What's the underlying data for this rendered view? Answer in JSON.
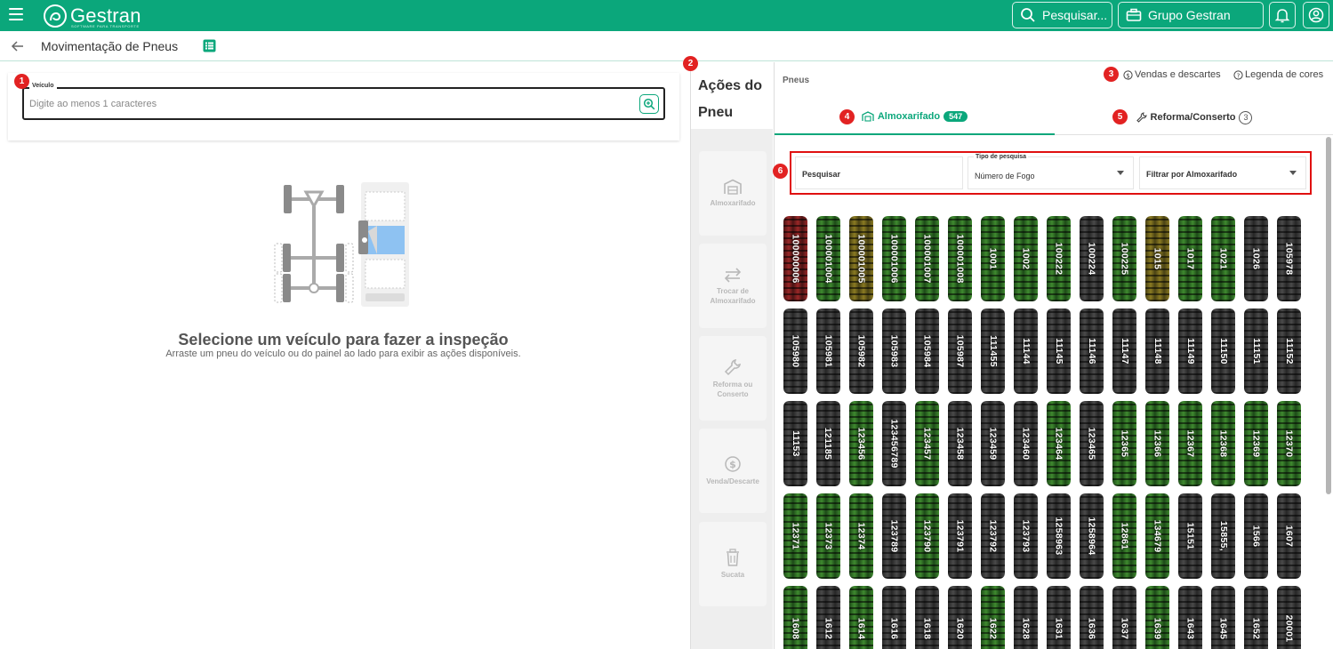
{
  "app": {
    "brand": "Gestran",
    "brand_sub": "SOFTWARE PARA TRANSPORTE",
    "search_label": "Pesquisar...",
    "company_label": "Grupo Gestran",
    "accent": "#0ba77b"
  },
  "page": {
    "title": "Movimentação de Pneus"
  },
  "markers": [
    "1",
    "2",
    "3",
    "4",
    "5",
    "6"
  ],
  "vehicle": {
    "label": "Veículo",
    "placeholder": "Digite ao menos 1 caracteres"
  },
  "empty_state": {
    "title": "Selecione um veículo para fazer a inspeção",
    "subtitle": "Arraste um pneu do veículo ou do painel ao lado para exibir as ações disponíveis."
  },
  "actions": {
    "title": "Ações do Pneu",
    "items": [
      {
        "label": "Almoxarifado",
        "icon": "warehouse-icon"
      },
      {
        "label": "Trocar de Almoxarifado",
        "icon": "swap-icon"
      },
      {
        "label": "Reforma ou Conserto",
        "icon": "wrench-icon"
      },
      {
        "label": "Venda/Descarte",
        "icon": "dollar-icon"
      },
      {
        "label": "Sucata",
        "icon": "trash-icon"
      }
    ]
  },
  "panel": {
    "title": "Pneus",
    "link_sales": "Vendas e descartes",
    "link_legend": "Legenda de cores",
    "tabs": [
      {
        "label": "Almoxarifado",
        "count": "547",
        "active": true
      },
      {
        "label": "Reforma/Conserto",
        "count": "3",
        "active": false
      }
    ],
    "filters": {
      "search_label": "Pesquisar",
      "type_label": "Tipo de pesquisa",
      "type_value": "Número de Fogo",
      "warehouse_label": "Filtrar por Almoxarifado"
    }
  },
  "tires": [
    {
      "id": "100000006",
      "color": "red"
    },
    {
      "id": "100001004",
      "color": "green"
    },
    {
      "id": "100001005",
      "color": "yellow"
    },
    {
      "id": "100001006",
      "color": "green"
    },
    {
      "id": "100001007",
      "color": "green"
    },
    {
      "id": "100001008",
      "color": "green"
    },
    {
      "id": "1001",
      "color": "green"
    },
    {
      "id": "1002",
      "color": "green"
    },
    {
      "id": "100222",
      "color": "green"
    },
    {
      "id": "100224",
      "color": "gray"
    },
    {
      "id": "100225",
      "color": "green"
    },
    {
      "id": "1015",
      "color": "yellow"
    },
    {
      "id": "1017",
      "color": "green"
    },
    {
      "id": "1021",
      "color": "green"
    },
    {
      "id": "1026",
      "color": "gray"
    },
    {
      "id": "105978",
      "color": "gray"
    },
    {
      "id": "105980",
      "color": "gray"
    },
    {
      "id": "105981",
      "color": "gray"
    },
    {
      "id": "105982",
      "color": "gray"
    },
    {
      "id": "105983",
      "color": "gray"
    },
    {
      "id": "105984",
      "color": "gray"
    },
    {
      "id": "105987",
      "color": "gray"
    },
    {
      "id": "111455",
      "color": "gray"
    },
    {
      "id": "11144",
      "color": "gray"
    },
    {
      "id": "11145",
      "color": "gray"
    },
    {
      "id": "11146",
      "color": "gray"
    },
    {
      "id": "11147",
      "color": "gray"
    },
    {
      "id": "11148",
      "color": "gray"
    },
    {
      "id": "11149",
      "color": "gray"
    },
    {
      "id": "11150",
      "color": "gray"
    },
    {
      "id": "11151",
      "color": "gray"
    },
    {
      "id": "11152",
      "color": "gray"
    },
    {
      "id": "11153",
      "color": "gray"
    },
    {
      "id": "121185",
      "color": "gray"
    },
    {
      "id": "123456",
      "color": "green"
    },
    {
      "id": "123456789",
      "color": "gray"
    },
    {
      "id": "123457",
      "color": "green"
    },
    {
      "id": "123458",
      "color": "gray"
    },
    {
      "id": "123459",
      "color": "gray"
    },
    {
      "id": "123460",
      "color": "gray"
    },
    {
      "id": "123464",
      "color": "green"
    },
    {
      "id": "123465",
      "color": "gray"
    },
    {
      "id": "12365",
      "color": "green"
    },
    {
      "id": "12366",
      "color": "green"
    },
    {
      "id": "12367",
      "color": "green"
    },
    {
      "id": "12368",
      "color": "green"
    },
    {
      "id": "12369",
      "color": "green"
    },
    {
      "id": "12370",
      "color": "green"
    },
    {
      "id": "12371",
      "color": "green"
    },
    {
      "id": "12373",
      "color": "green"
    },
    {
      "id": "12374",
      "color": "green"
    },
    {
      "id": "123789",
      "color": "gray"
    },
    {
      "id": "123790",
      "color": "green"
    },
    {
      "id": "123791",
      "color": "gray"
    },
    {
      "id": "123792",
      "color": "gray"
    },
    {
      "id": "123793",
      "color": "gray"
    },
    {
      "id": "1258963",
      "color": "gray"
    },
    {
      "id": "1258964",
      "color": "gray"
    },
    {
      "id": "12861",
      "color": "green"
    },
    {
      "id": "134679",
      "color": "green"
    },
    {
      "id": "15151",
      "color": "gray"
    },
    {
      "id": "15855,",
      "color": "gray"
    },
    {
      "id": "1566",
      "color": "gray"
    },
    {
      "id": "1607",
      "color": "gray"
    },
    {
      "id": "1608",
      "color": "green"
    },
    {
      "id": "1612",
      "color": "gray"
    },
    {
      "id": "1614",
      "color": "green"
    },
    {
      "id": "1616",
      "color": "gray"
    },
    {
      "id": "1618",
      "color": "gray"
    },
    {
      "id": "1620",
      "color": "gray"
    },
    {
      "id": "1622",
      "color": "green"
    },
    {
      "id": "1628",
      "color": "gray"
    },
    {
      "id": "1631",
      "color": "gray"
    },
    {
      "id": "1636",
      "color": "gray"
    },
    {
      "id": "1637",
      "color": "gray"
    },
    {
      "id": "1639",
      "color": "green"
    },
    {
      "id": "1643",
      "color": "gray"
    },
    {
      "id": "1645",
      "color": "gray"
    },
    {
      "id": "1652",
      "color": "gray"
    },
    {
      "id": "20001",
      "color": "gray"
    }
  ],
  "tire_colors": {
    "green": [
      "#1d4a18",
      "#3f8a2f"
    ],
    "gray": [
      "#262626",
      "#4a4a4a"
    ],
    "red": [
      "#4a1414",
      "#9a2727"
    ],
    "yellow": [
      "#4a4314",
      "#8a7a22"
    ]
  }
}
